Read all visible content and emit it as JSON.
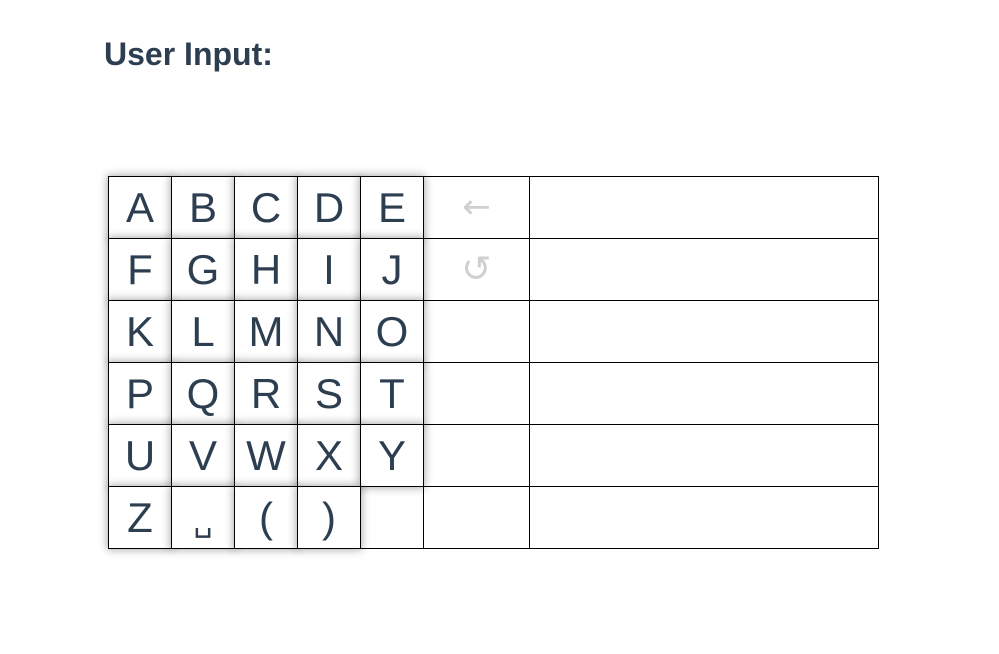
{
  "heading": "User Input:",
  "keys": {
    "row1": [
      "A",
      "B",
      "C",
      "D",
      "E"
    ],
    "row2": [
      "F",
      "G",
      "H",
      "I",
      "J"
    ],
    "row3": [
      "K",
      "L",
      "M",
      "N",
      "O"
    ],
    "row4": [
      "P",
      "Q",
      "R",
      "S",
      "T"
    ],
    "row5": [
      "U",
      "V",
      "W",
      "X",
      "Y"
    ],
    "row6": [
      "Z",
      "␣",
      "(",
      ")"
    ]
  },
  "actions": {
    "backspace": "←",
    "reset": "↺"
  },
  "input_lines": [
    "",
    "",
    "",
    "",
    "",
    ""
  ]
}
